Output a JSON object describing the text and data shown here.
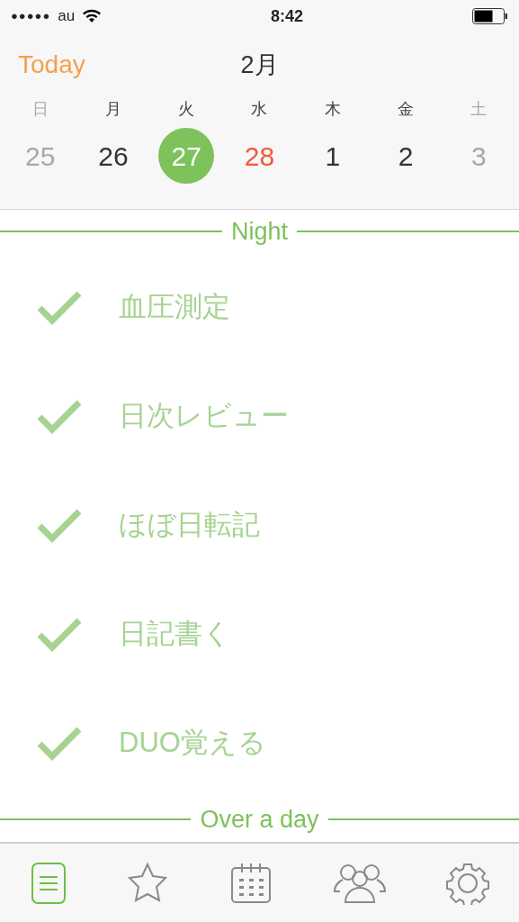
{
  "status_bar": {
    "signal_dots": "●●●●●",
    "carrier": "au",
    "time": "8:42"
  },
  "header": {
    "today_button": "Today",
    "month": "2月"
  },
  "week": [
    {
      "weekday": "日",
      "weekday_muted": true,
      "date": "25",
      "color": "#a8a8a8",
      "selected": false
    },
    {
      "weekday": "月",
      "weekday_muted": false,
      "date": "26",
      "color": "#333333",
      "selected": false
    },
    {
      "weekday": "火",
      "weekday_muted": false,
      "date": "27",
      "color": "#7dc25a",
      "selected": true
    },
    {
      "weekday": "水",
      "weekday_muted": false,
      "date": "28",
      "color": "#f2583e",
      "selected": false
    },
    {
      "weekday": "木",
      "weekday_muted": false,
      "date": "1",
      "color": "#333333",
      "selected": false
    },
    {
      "weekday": "金",
      "weekday_muted": false,
      "date": "2",
      "color": "#333333",
      "selected": false
    },
    {
      "weekday": "土",
      "weekday_muted": true,
      "date": "3",
      "color": "#a8a8a8",
      "selected": false
    }
  ],
  "sections": [
    {
      "title": "Night",
      "tasks": [
        {
          "label": "血圧測定",
          "checked": true
        },
        {
          "label": "日次レビュー",
          "checked": true
        },
        {
          "label": "ほぼ日転記",
          "checked": true
        },
        {
          "label": "日記書く",
          "checked": true
        },
        {
          "label": "DUO覚える",
          "checked": true
        }
      ]
    },
    {
      "title": "Over a day"
    }
  ],
  "tab_bar": [
    {
      "kind": "list",
      "selected": true
    },
    {
      "kind": "star",
      "selected": false
    },
    {
      "kind": "calendar",
      "selected": false
    },
    {
      "kind": "people",
      "selected": false
    },
    {
      "kind": "gear",
      "selected": false
    }
  ]
}
